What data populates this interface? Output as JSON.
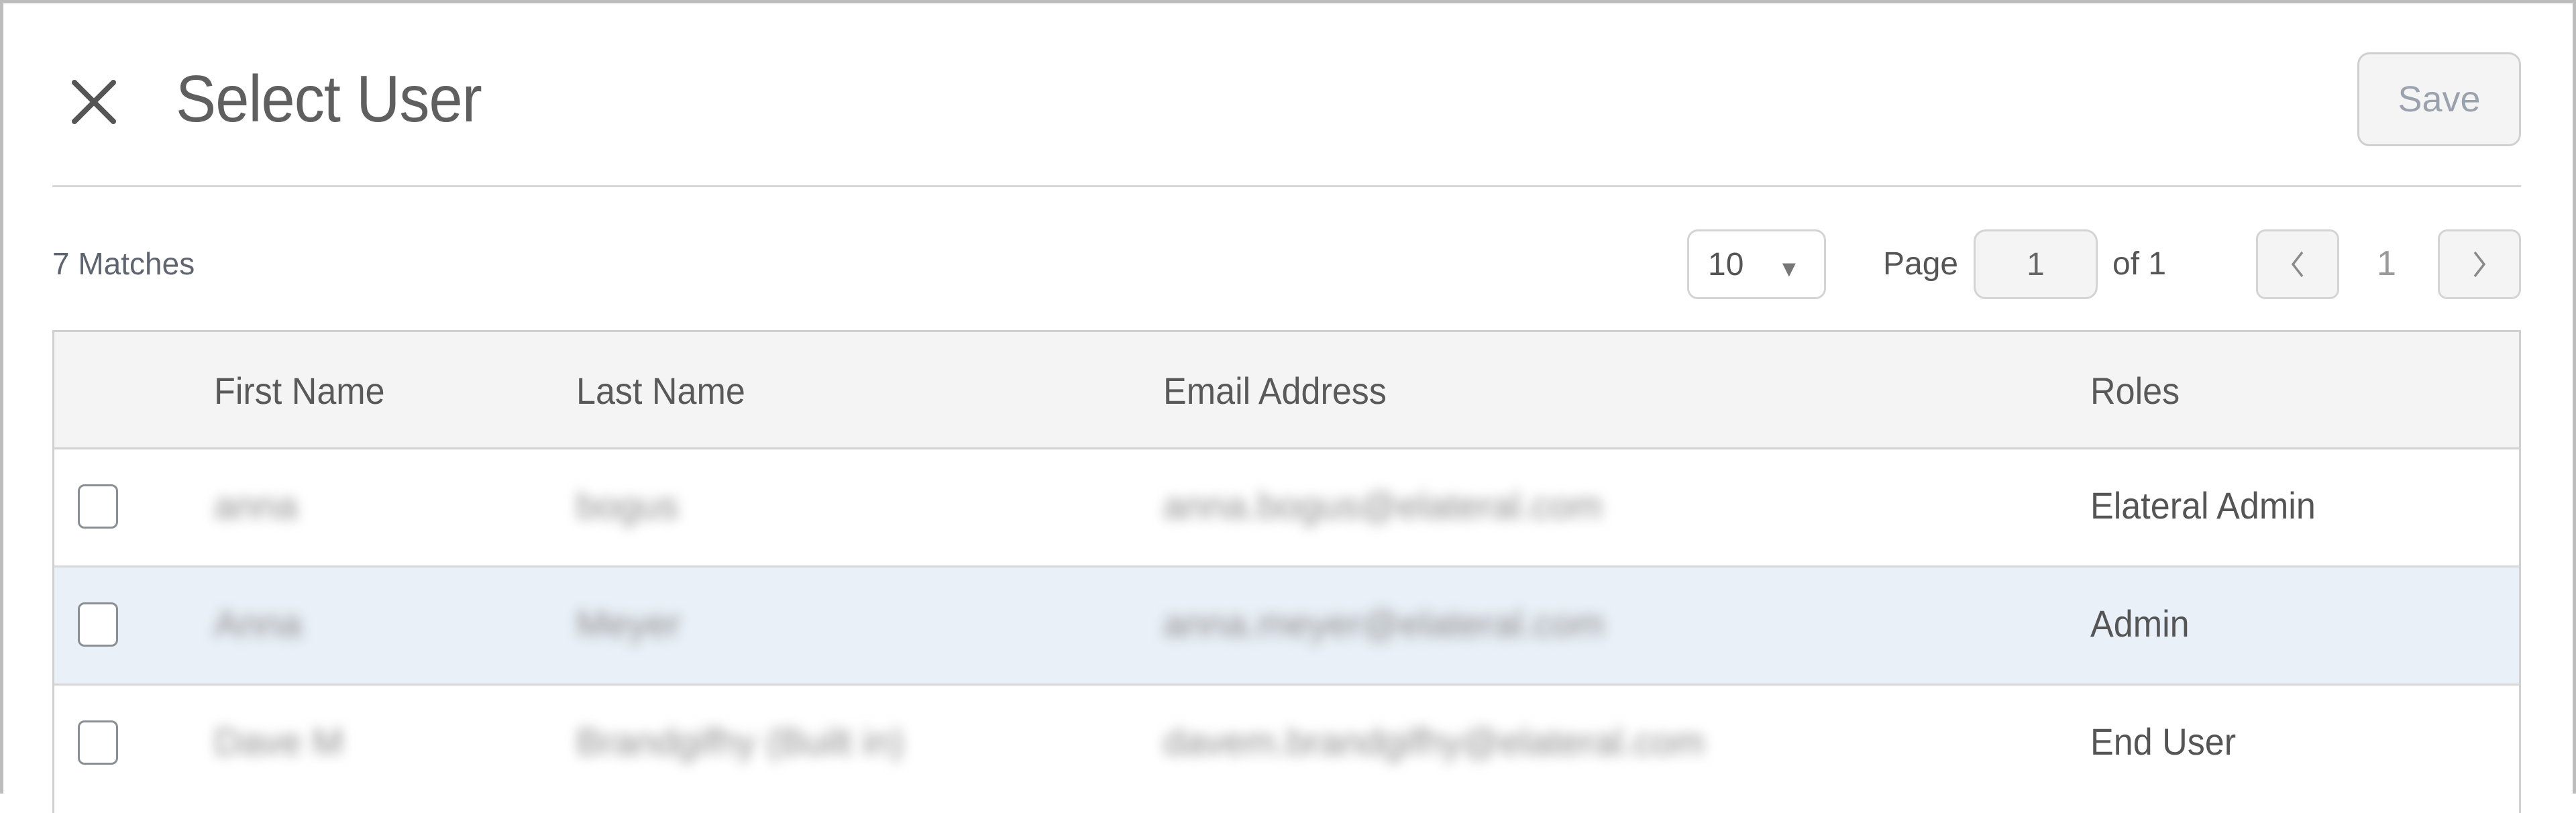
{
  "dialog": {
    "title": "Select User",
    "close_icon": "close-icon",
    "save_label": "Save"
  },
  "toolbar": {
    "matches_label": "7 Matches",
    "page_size": "10",
    "page_size_caret": "▼",
    "page_label": "Page",
    "page_value": "1",
    "of_label": "of 1",
    "current_page": "1",
    "prev_icon": "chevron-left-icon",
    "next_icon": "chevron-right-icon"
  },
  "table": {
    "columns": [
      "First Name",
      "Last Name",
      "Email Address",
      "Roles"
    ],
    "rows": [
      {
        "first": "anna",
        "last": "bogus",
        "email": "anna.bogus@elateral.com",
        "role": "Elateral Admin",
        "checked": false,
        "highlighted": false
      },
      {
        "first": "Anna",
        "last": "Meyer",
        "email": "anna.meyer@elateral.com",
        "role": "Admin",
        "checked": false,
        "highlighted": true
      },
      {
        "first": "Dave M",
        "last": "Brandgifhy (Built in)",
        "email": "davem.brandgifhy@elateral.com",
        "role": "End User",
        "checked": false,
        "highlighted": false
      }
    ]
  },
  "colors": {
    "header_bg": "#f4f4f4",
    "highlight_row": "#e9f0f7",
    "border": "#d0d0d0",
    "save_text": "#9aa3ad"
  }
}
